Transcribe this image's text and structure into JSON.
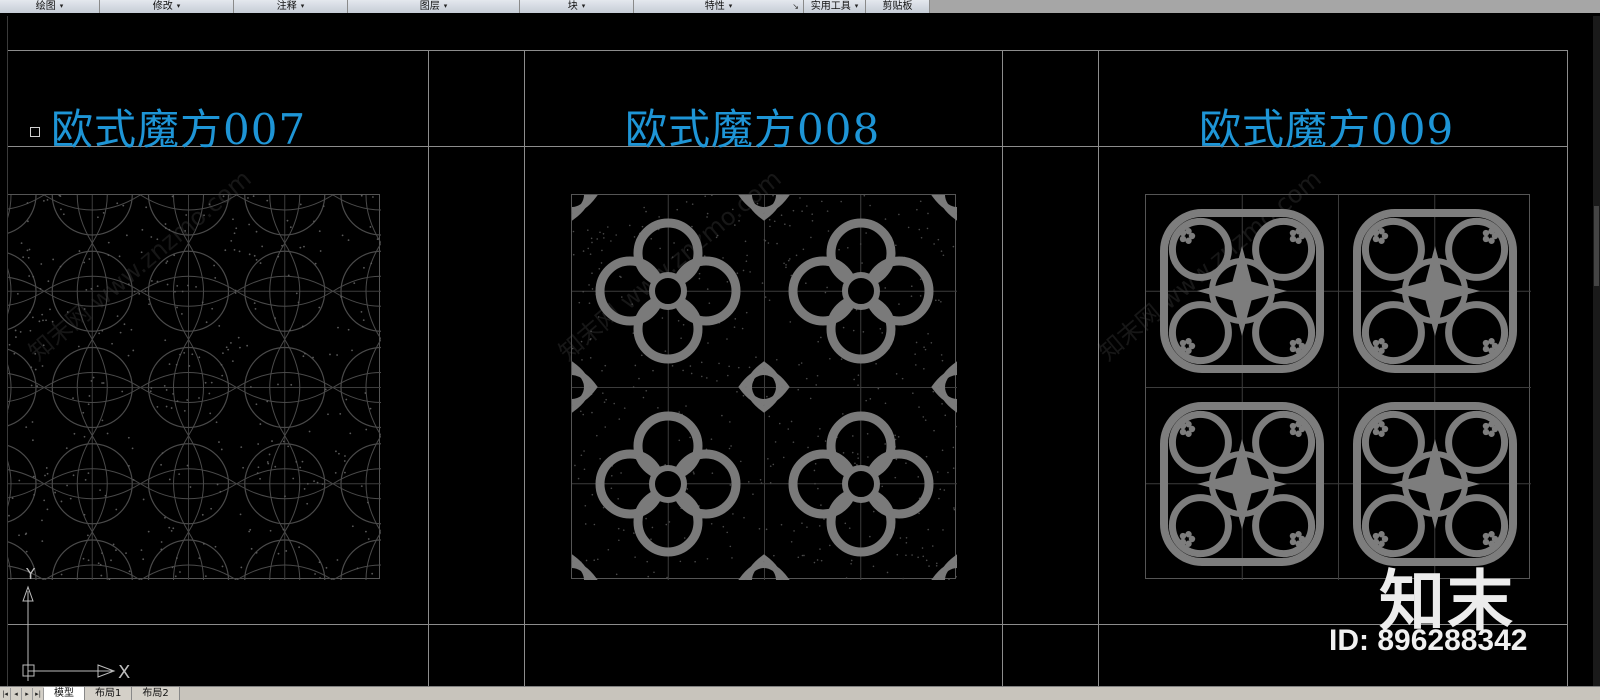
{
  "ribbon": {
    "groups": [
      {
        "label": "绘图"
      },
      {
        "label": "修改"
      },
      {
        "label": "注释"
      },
      {
        "label": "图层"
      },
      {
        "label": "块"
      },
      {
        "label": "特性"
      },
      {
        "label": "实用工具"
      },
      {
        "label": "剪贴板"
      }
    ],
    "caret": "▾",
    "launcher": "↘"
  },
  "drawing": {
    "titles": [
      "欧式魔方007",
      "欧式魔方008",
      "欧式魔方009"
    ],
    "watermark_text": "知末网 www.znzmo.com",
    "ucs": {
      "y_label": "Y",
      "x_label": "X"
    },
    "colors": {
      "background": "#000000",
      "title": "#1e95d6",
      "frame_line": "#8c8c8c",
      "pattern_007": "#4a4a4a",
      "pattern_008": "#7a7a7a",
      "pattern_009": "#7d7d7d"
    }
  },
  "brand": {
    "logo": "知末",
    "id_text": "ID: 896288342"
  },
  "layout_tabs": {
    "nav_buttons": [
      "|◂",
      "◂",
      "▸",
      "▸|"
    ],
    "tabs": [
      {
        "label": "模型",
        "active": true
      },
      {
        "label": "布局1",
        "active": false
      },
      {
        "label": "布局2",
        "active": false
      }
    ]
  }
}
